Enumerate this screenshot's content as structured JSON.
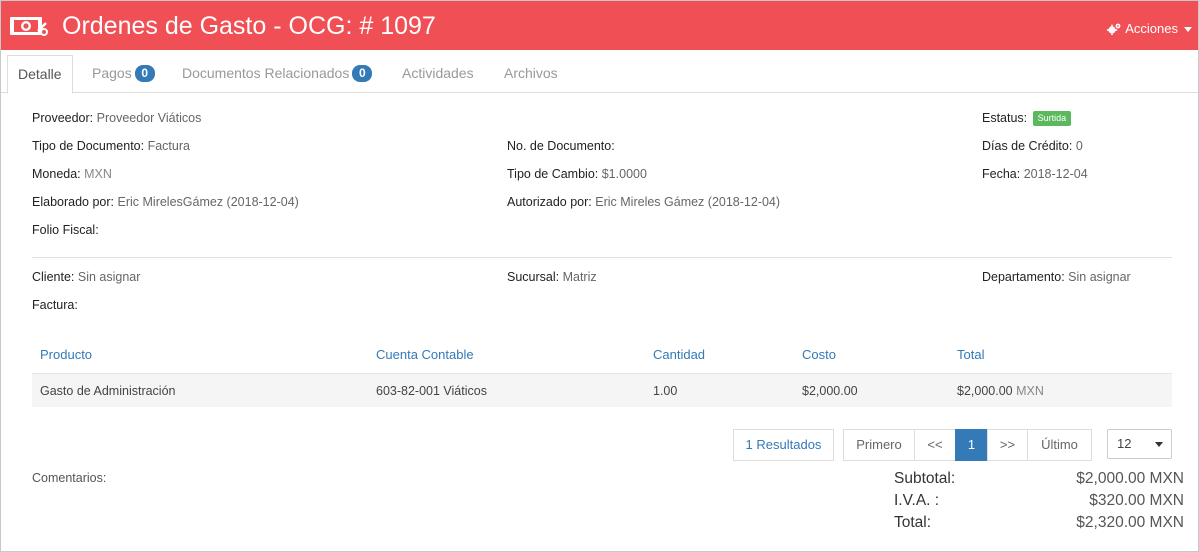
{
  "header": {
    "title": "Ordenes de Gasto - OCG: # 1097",
    "actions_label": "Acciones",
    "color": "#ef4f55",
    "logo_icon": "money-bill-icon"
  },
  "tabs": [
    {
      "label": "Detalle",
      "active": true
    },
    {
      "label": "Pagos",
      "badge": "0"
    },
    {
      "label": "Documentos Relacionados",
      "badge": "0"
    },
    {
      "label": "Actividades"
    },
    {
      "label": "Archivos"
    }
  ],
  "details": {
    "proveedor": {
      "label": "Proveedor:",
      "value": "Proveedor Viáticos"
    },
    "estatus": {
      "label": "Estatus:",
      "value": "Surtida",
      "color": "#5cb85c"
    },
    "tipo_documento": {
      "label": "Tipo de Documento:",
      "value": "Factura"
    },
    "no_documento": {
      "label": "No. de Documento:",
      "value": ""
    },
    "dias_credito": {
      "label": "Días de Crédito:",
      "value": "0"
    },
    "moneda": {
      "label": "Moneda:",
      "value": "MXN"
    },
    "tipo_cambio": {
      "label": "Tipo de Cambio:",
      "value": "$1.0000"
    },
    "fecha": {
      "label": "Fecha:",
      "value": "2018-12-04"
    },
    "elaborado_por": {
      "label": "Elaborado por:",
      "value": "Eric MirelesGámez (2018-12-04)"
    },
    "autorizado_por": {
      "label": "Autorizado por:",
      "value": "Eric Mireles Gámez (2018-12-04)"
    },
    "folio_fiscal": {
      "label": "Folio Fiscal:",
      "value": ""
    },
    "cliente": {
      "label": "Cliente:",
      "value": "Sin asignar"
    },
    "sucursal": {
      "label": "Sucursal:",
      "value": "Matriz"
    },
    "departamento": {
      "label": "Departamento:",
      "value": "Sin asignar"
    },
    "factura": {
      "label": "Factura:",
      "value": ""
    }
  },
  "table": {
    "headers": [
      "Producto",
      "Cuenta Contable",
      "Cantidad",
      "Costo",
      "Total"
    ],
    "rows": [
      {
        "producto": "Gasto de Administración",
        "cuenta": "603-82-001 Viáticos",
        "cantidad": "1.00",
        "costo": "$2,000.00",
        "total": "$2,000.00",
        "moneda": "MXN"
      }
    ]
  },
  "pagination": {
    "results": "1 Resultados",
    "first": "Primero",
    "prev": "<<",
    "current": "1",
    "next": ">>",
    "last": "Último",
    "page_size": "12"
  },
  "comments_label": "Comentarios:",
  "totals": {
    "subtotal": {
      "label": "Subtotal:",
      "value": "$2,000.00 MXN"
    },
    "iva": {
      "label": "I.V.A. :",
      "value": "$320.00 MXN"
    },
    "total": {
      "label": "Total:",
      "value": "$2,320.00 MXN"
    }
  }
}
